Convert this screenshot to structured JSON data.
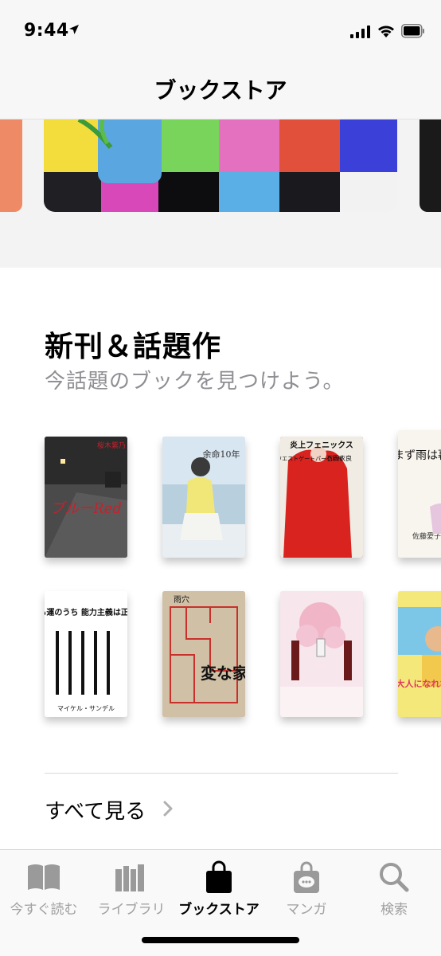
{
  "status": {
    "time": "9:44"
  },
  "nav": {
    "title": "ブックストア"
  },
  "section": {
    "title": "新刊＆話題作",
    "subtitle": "今話題のブックを見つけよう。",
    "see_all": "すべて見る"
  },
  "books": [
    {
      "title_text": "ブルーRed",
      "author_text": "桜木紫乃",
      "color": "#3b3b3b"
    },
    {
      "title_text": "余命10年",
      "author_text": "",
      "color": "#cfe0ee"
    },
    {
      "title_text": "炎上フェニックス",
      "author_text": "石田衣良",
      "subtitle_text": "池袋ウエストゲートパークXVII",
      "color": "#d8231f"
    },
    {
      "title_text": "やまず雨は暮れず",
      "author_text": "佐藤愛子",
      "color": "#f7f4ec"
    },
    {
      "title_text": "実力も運のうち 能力主義は正義か?",
      "author_text": "マイケル・サンデル",
      "color": "#ffffff"
    },
    {
      "title_text": "変な家",
      "author_text": "雨穴",
      "color": "#c9b9a0"
    },
    {
      "title_text": "",
      "author_text": "",
      "color": "#f6e4ea"
    },
    {
      "title_text": "大人になれない",
      "author_text": "",
      "color": "#f3e26a"
    }
  ],
  "tabs": [
    {
      "label": "今すぐ読む",
      "icon": "book-open-icon",
      "active": false
    },
    {
      "label": "ライブラリ",
      "icon": "library-icon",
      "active": false
    },
    {
      "label": "ブックストア",
      "icon": "shopping-bag-icon",
      "active": true
    },
    {
      "label": "マンガ",
      "icon": "manga-bag-icon",
      "active": false
    },
    {
      "label": "検索",
      "icon": "search-icon",
      "active": false
    }
  ],
  "colors": {
    "accent": "#000000",
    "inactive_tab": "#a0a0a0",
    "subtitle_gray": "#8e8e93"
  }
}
